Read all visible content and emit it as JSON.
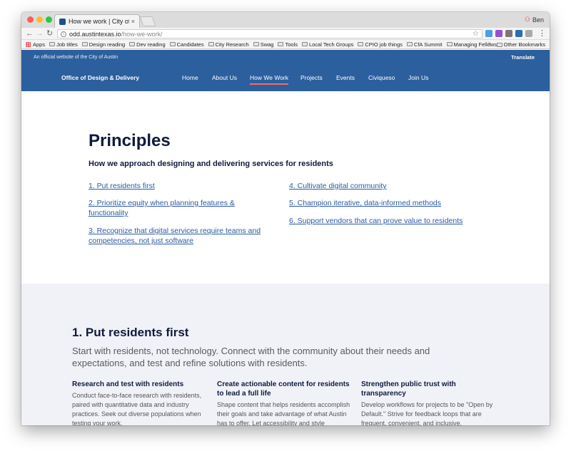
{
  "browser": {
    "tab_title": "How we work | City of Austin D",
    "tab_close": "×",
    "profile_name": "Ben",
    "url_host": "odd.austintexas.io",
    "url_path": "/how-we-work/",
    "bookmarks": [
      "Apps",
      "Job titles",
      "Design reading",
      "Dev reading",
      "Candidates",
      "City Research",
      "Swag",
      "Tools",
      "Local Tech Groups",
      "CPIO job things",
      "CfA Summit",
      "Managing Fellows"
    ],
    "bookmarks_more": "»",
    "other_bookmarks": "Other Bookmarks"
  },
  "site": {
    "official_notice": "An official website of the City of Austin",
    "translate": "Translate",
    "brand": "Office of Design & Delivery",
    "nav": [
      "Home",
      "About Us",
      "How We Work",
      "Projects",
      "Events",
      "Civiqueso",
      "Join Us"
    ],
    "active_nav": "How We Work"
  },
  "principles": {
    "title": "Principles",
    "subtitle": "How we approach designing and delivering services for residents",
    "items": [
      "1. Put residents first",
      "2. Prioritize equity when planning features & functionality",
      "3. Recognize that digital services require teams and competencies, not just software",
      "4. Cultivate digital community",
      "5. Champion iterative, data-informed methods",
      "6. Support vendors that can prove value to residents"
    ]
  },
  "section1": {
    "title": "1. Put residents first",
    "lead": "Start with residents, not technology. Connect with the community about their needs and expectations, and test and refine solutions with residents.",
    "columns": [
      {
        "heading": "Research and test with residents",
        "text": "Conduct face-to-face research with residents, paired with quantitative data and industry practices. Seek out diverse populations when testing your work."
      },
      {
        "heading": "Create actionable content for residents to lead a full life",
        "text": "Shape content that helps residents accomplish their goals and take advantage of what Austin has to offer. Let accessibility and style"
      },
      {
        "heading": "Strengthen public trust with transparency",
        "text": "Develop workflows for projects to be \"Open by Default.\" Strive for feedback loops that are frequent, convenient, and inclusive."
      }
    ]
  },
  "colors": {
    "header_blue": "#2c5f9e",
    "nav_active_underline": "#e8736a",
    "heading_navy": "#0f1b3d",
    "link_blue": "#2b5aa3",
    "section_bg": "#f1f2f8"
  }
}
